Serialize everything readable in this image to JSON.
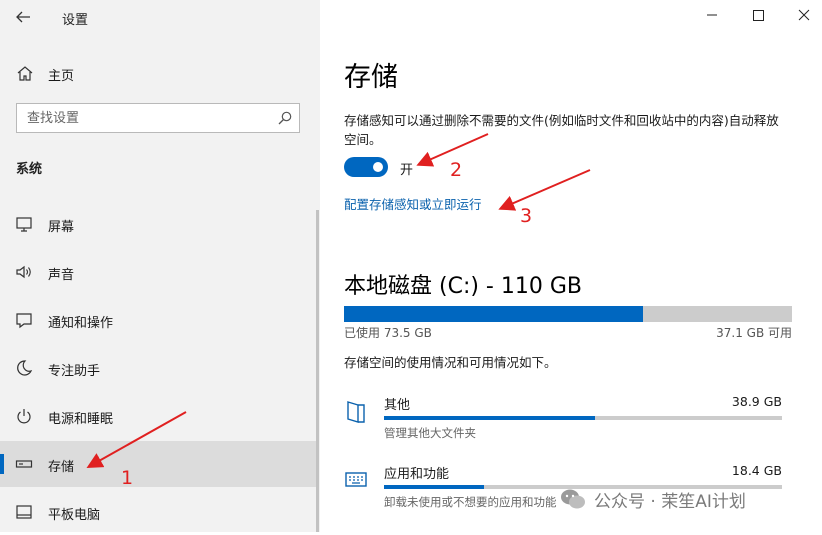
{
  "window": {
    "title": "设置",
    "controls": [
      "minimize-icon",
      "maximize-icon",
      "close-icon"
    ]
  },
  "sidebar": {
    "home_label": "主页",
    "search_placeholder": "查找设置",
    "section_title": "系统",
    "items": [
      {
        "label": "屏幕",
        "icon": "monitor-icon",
        "active": false
      },
      {
        "label": "声音",
        "icon": "speaker-icon",
        "active": false
      },
      {
        "label": "通知和操作",
        "icon": "notification-icon",
        "active": false
      },
      {
        "label": "专注助手",
        "icon": "moon-icon",
        "active": false
      },
      {
        "label": "电源和睡眠",
        "icon": "power-icon",
        "active": false
      },
      {
        "label": "存储",
        "icon": "storage-icon",
        "active": true
      },
      {
        "label": "平板电脑",
        "icon": "tablet-icon",
        "active": false
      }
    ]
  },
  "main": {
    "title": "存储",
    "storage_sense_desc": "存储感知可以通过删除不需要的文件(例如临时文件和回收站中的内容)自动释放空间。",
    "toggle": {
      "state": "on",
      "label": "开"
    },
    "config_link": "配置存储感知或立即运行",
    "disk": {
      "title": "本地磁盘 (C:) - 110 GB",
      "used_text": "已使用 73.5 GB",
      "free_text": "37.1 GB 可用",
      "used_fraction": 0.668
    },
    "usage_desc": "存储空间的使用情况和可用情况如下。",
    "categories": [
      {
        "name": "其他",
        "size": "38.9 GB",
        "sub": "管理其他大文件夹",
        "fraction": 0.53,
        "icon": "folder-icon"
      },
      {
        "name": "应用和功能",
        "size": "18.4 GB",
        "sub": "卸载未使用或不想要的应用和功能",
        "fraction": 0.25,
        "icon": "keyboard-icon"
      }
    ]
  },
  "annotations": [
    "1",
    "2",
    "3"
  ],
  "watermark": "公众号 · 茉笙AI计划",
  "colors": {
    "accent": "#0067c0",
    "annotation": "#e02020",
    "sidebar_bg": "#f2f2f2"
  }
}
